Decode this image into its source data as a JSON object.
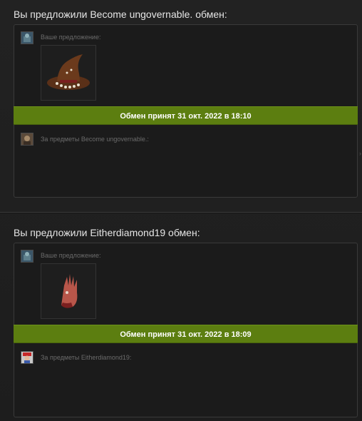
{
  "offers": [
    {
      "title": "Вы предложили Become ungovernable. обмен:",
      "your_offer_label": "Ваше предложение:",
      "your_item_icon": "witch-hat-icon",
      "status": "Обмен принят 31 окт. 2022 в 18:10",
      "their_items_label": "За предметы Become ungovernable.:"
    },
    {
      "title": "Вы предложили Eitherdiamond19 обмен:",
      "your_offer_label": "Ваше предложение:",
      "your_item_icon": "severed-hand-icon",
      "status": "Обмен принят 31 окт. 2022 в 18:09",
      "their_items_label": "За предметы Eitherdiamond19:"
    }
  ],
  "colors": {
    "status_bar": "#5c7e10",
    "background": "#1f1f1f",
    "card": "#1b1b1b"
  }
}
